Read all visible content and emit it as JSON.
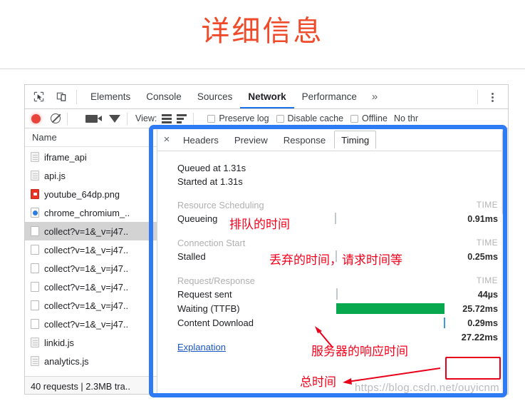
{
  "page": {
    "title": "详细信息",
    "watermark": "https://blog.csdn.net/ouyicnm"
  },
  "devtools": {
    "icons": {
      "inspect": "inspect-element-icon",
      "device": "device-toolbar-icon",
      "kebab": "more-options-icon"
    },
    "tabs": [
      {
        "label": "Elements",
        "active": false
      },
      {
        "label": "Console",
        "active": false
      },
      {
        "label": "Sources",
        "active": false
      },
      {
        "label": "Network",
        "active": true
      },
      {
        "label": "Performance",
        "active": false
      }
    ],
    "more_tabs_label": "»",
    "toolbar": {
      "record_label": "record-button",
      "clear_label": "clear-button",
      "camera_label": "capture-screenshots-button",
      "filter_label": "filter-button",
      "view_label": "View:",
      "checkboxes": [
        {
          "label": "Preserve log",
          "checked": false
        },
        {
          "label": "Disable cache",
          "checked": false
        },
        {
          "label": "Offline",
          "checked": false
        }
      ],
      "throttle_label": "No thr"
    }
  },
  "requests": {
    "column_header": "Name",
    "rows": [
      {
        "name": "iframe_api",
        "icon": "document-icon",
        "selected": false
      },
      {
        "name": "api.js",
        "icon": "document-icon",
        "selected": false
      },
      {
        "name": "youtube_64dp.png",
        "icon": "image-icon",
        "selected": false
      },
      {
        "name": "chrome_chromium_..",
        "icon": "other-icon",
        "selected": false
      },
      {
        "name": "collect?v=1&_v=j47..",
        "icon": "blank-icon",
        "selected": true
      },
      {
        "name": "collect?v=1&_v=j47..",
        "icon": "blank-icon",
        "selected": false
      },
      {
        "name": "collect?v=1&_v=j47..",
        "icon": "blank-icon",
        "selected": false
      },
      {
        "name": "collect?v=1&_v=j47..",
        "icon": "blank-icon",
        "selected": false
      },
      {
        "name": "collect?v=1&_v=j47..",
        "icon": "blank-icon",
        "selected": false
      },
      {
        "name": "collect?v=1&_v=j47..",
        "icon": "blank-icon",
        "selected": false
      },
      {
        "name": "linkid.js",
        "icon": "document-icon",
        "selected": false
      },
      {
        "name": "analytics.js",
        "icon": "document-icon",
        "selected": false
      }
    ],
    "status": "40 requests | 2.3MB tra.."
  },
  "detail": {
    "close_label": "×",
    "tabs": [
      {
        "label": "Headers",
        "active": false
      },
      {
        "label": "Preview",
        "active": false
      },
      {
        "label": "Response",
        "active": false
      },
      {
        "label": "Timing",
        "active": true
      }
    ],
    "queued": "Queued at 1.31s",
    "started": "Started at 1.31s",
    "time_col_header": "TIME",
    "groups": [
      {
        "title": "Resource Scheduling",
        "rows": [
          {
            "label": "Queueing",
            "value": "0.91ms"
          }
        ]
      },
      {
        "title": "Connection Start",
        "rows": [
          {
            "label": "Stalled",
            "value": "0.25ms"
          }
        ]
      },
      {
        "title": "Request/Response",
        "rows": [
          {
            "label": "Request sent",
            "value": "44µs"
          },
          {
            "label": "Waiting (TTFB)",
            "value": "25.72ms"
          },
          {
            "label": "Content Download",
            "value": "0.29ms"
          }
        ]
      }
    ],
    "explanation": "Explanation",
    "total": "27.22ms"
  },
  "annotations": {
    "queueing": "排队的时间",
    "stalled": "丢弃的时间，请求时间等",
    "ttfb": "服务器的响应时间",
    "total": "总时间"
  },
  "colors": {
    "title": "#ef4a2a",
    "annotation": "#f4001b",
    "highlight_frame": "#2f7bf4",
    "ttfb_bar": "#07a84e",
    "download_bar": "#3b9ae1",
    "active_tab_underline": "#1a73e8",
    "link": "#1a56c4"
  }
}
